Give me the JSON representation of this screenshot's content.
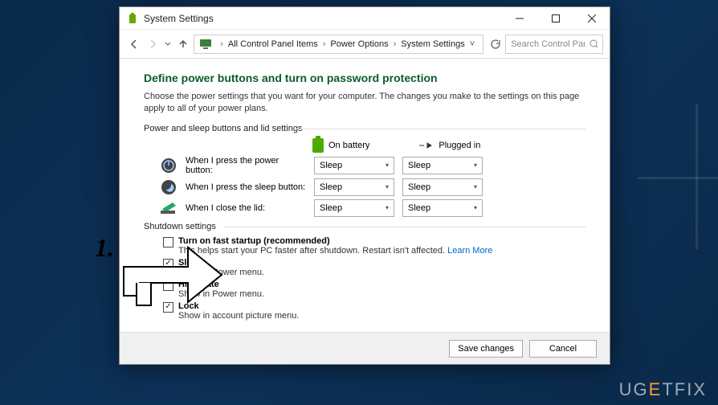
{
  "window": {
    "title": "System Settings",
    "minimize_tooltip": "Minimize",
    "maximize_tooltip": "Maximize",
    "close_tooltip": "Close"
  },
  "breadcrumb": {
    "items": [
      "All Control Panel Items",
      "Power Options",
      "System Settings"
    ]
  },
  "search": {
    "placeholder": "Search Control Panel"
  },
  "main": {
    "heading": "Define power buttons and turn on password protection",
    "description": "Choose the power settings that you want for your computer. The changes you make to the settings on this page apply to all of your power plans.",
    "group1_title": "Power and sleep buttons and lid settings",
    "columns": {
      "battery": "On battery",
      "plugged": "Plugged in"
    },
    "rows": [
      {
        "label": "When I press the power button:",
        "battery": "Sleep",
        "plugged": "Sleep"
      },
      {
        "label": "When I press the sleep button:",
        "battery": "Sleep",
        "plugged": "Sleep"
      },
      {
        "label": "When I close the lid:",
        "battery": "Sleep",
        "plugged": "Sleep"
      }
    ],
    "group2_title": "Shutdown settings",
    "shutdown": [
      {
        "label": "Turn on fast startup (recommended)",
        "desc": "This helps start your PC faster after shutdown. Restart isn't affected. ",
        "link": "Learn More",
        "checked": false
      },
      {
        "label": "Sleep",
        "desc": "Show in Power menu.",
        "checked": true
      },
      {
        "label": "Hibernate",
        "desc": "Show in Power menu.",
        "checked": false
      },
      {
        "label": "Lock",
        "desc": "Show in account picture menu.",
        "checked": true
      }
    ]
  },
  "footer": {
    "save": "Save changes",
    "cancel": "Cancel"
  },
  "annotation": {
    "step": "1."
  },
  "watermark": "UGETFIX"
}
